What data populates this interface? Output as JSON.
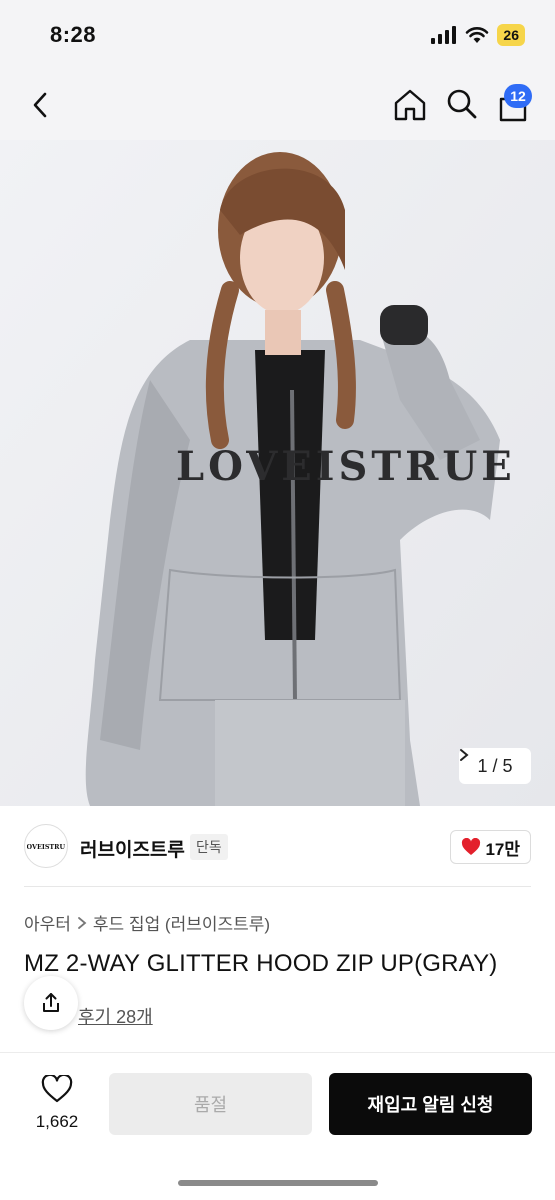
{
  "status": {
    "time": "8:28",
    "battery": "26"
  },
  "nav": {
    "cart_badge": "12"
  },
  "gallery": {
    "current": "1 / 5"
  },
  "brand": {
    "name": "러브이즈트루",
    "tag": "단독",
    "likes": "17만",
    "logo_text": "LOVEISTRUE"
  },
  "product": {
    "breadcrumb": [
      "아우터",
      "후드 집업 (러브이즈트루)"
    ],
    "title": "MZ 2-WAY GLITTER HOOD ZIP UP(GRAY)",
    "reviews": "후기 28개",
    "hoodie_print": "LOVEISTRUE"
  },
  "bottom": {
    "wish_count": "1,662",
    "soldout_label": "품절",
    "restock_label": "재입고 알림 신청"
  },
  "colors": {
    "accent": "#2f6cf6",
    "heart": "#e3202c",
    "cta": "#0b0b0b"
  }
}
